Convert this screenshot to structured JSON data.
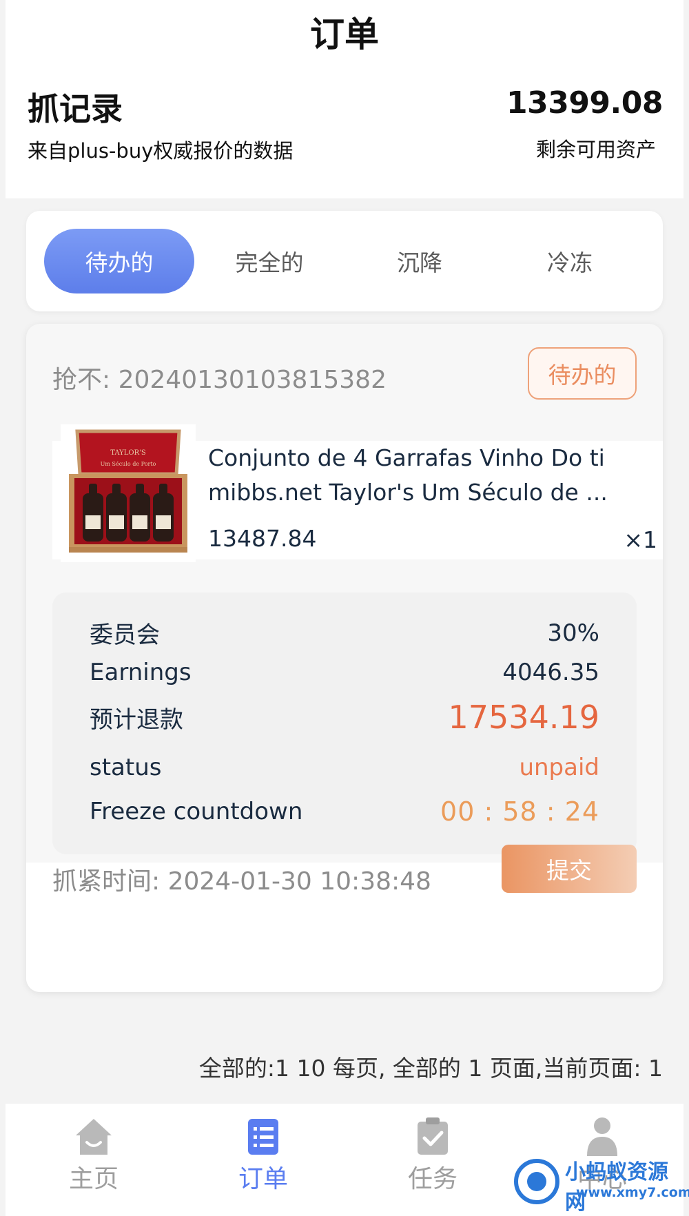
{
  "header": {
    "title": "订单",
    "section_title": "抓记录",
    "section_subtitle": "来自plus-buy权威报价的数据",
    "balance": "13399.08",
    "balance_label": "剩余可用资产"
  },
  "tabs": [
    {
      "label": "待办的",
      "active": true
    },
    {
      "label": "完全的",
      "active": false
    },
    {
      "label": "沉降",
      "active": false
    },
    {
      "label": "冷冻",
      "active": false
    }
  ],
  "order": {
    "number_label": "抢不:",
    "number": "20240130103815382",
    "status_badge": "待办的",
    "product": {
      "name_line1": "Conjunto de 4 Garrafas Vinho Do ti",
      "name_line2": "mibbs.net Taylor's Um Século de ...",
      "price": "13487.84",
      "quantity": "×1",
      "image_icon": "wine-box-image"
    },
    "details": [
      {
        "label": "委员会",
        "value": "30%"
      },
      {
        "label": "Earnings",
        "value": "4046.35"
      },
      {
        "label": "预计退款",
        "value": "17534.19"
      },
      {
        "label": "status",
        "value": "unpaid"
      },
      {
        "label": "Freeze countdown",
        "value": "00 : 58 : 24"
      }
    ],
    "grab_time_label": "抓紧时间:",
    "grab_time": "2024-01-30 10:38:48",
    "submit_label": "提交"
  },
  "pagination": "全部的:1 10 每页, 全部的 1 页面,当前页面: 1",
  "bottom_nav": [
    {
      "label": "主页",
      "icon": "home-icon",
      "active": false
    },
    {
      "label": "订单",
      "icon": "order-list-icon",
      "active": true
    },
    {
      "label": "任务",
      "icon": "task-clipboard-icon",
      "active": false
    },
    {
      "label": "中心",
      "icon": "user-icon",
      "active": false
    }
  ],
  "watermark": {
    "name": "小蚂蚁资源网",
    "url": "www.xmy7.com"
  },
  "colors": {
    "accent_blue": "#5d7eea",
    "orange": "#ea8d60",
    "refund_red": "#e5663f"
  }
}
